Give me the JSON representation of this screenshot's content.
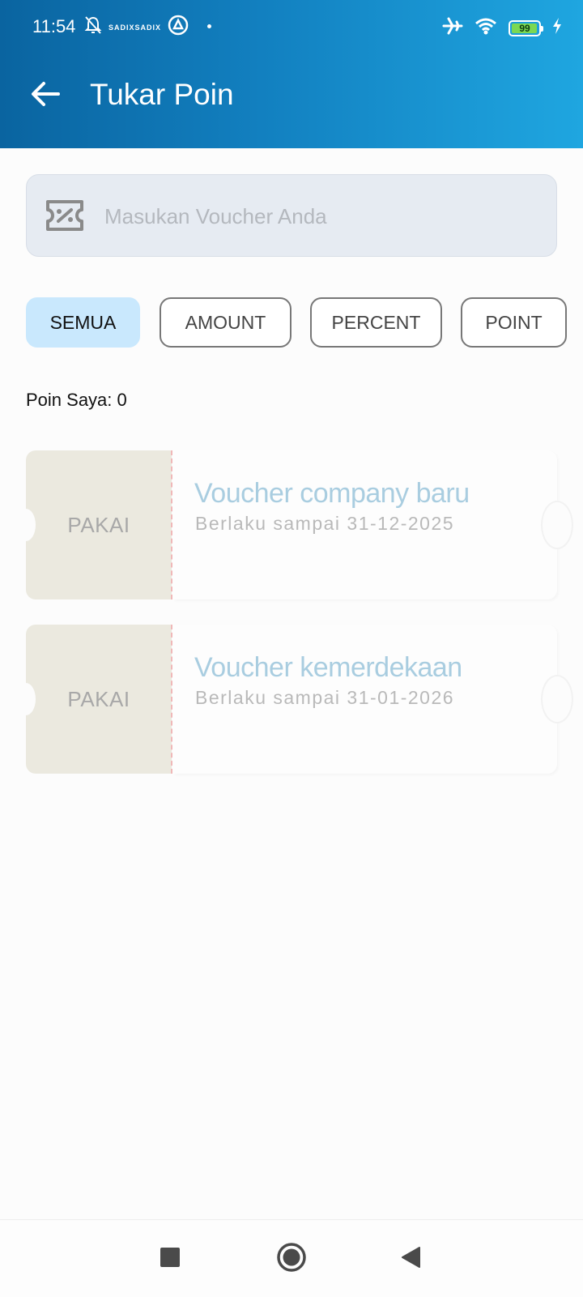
{
  "status_bar": {
    "time": "11:54",
    "carrier": "SADIXSADIX",
    "battery_level": "99",
    "icons": [
      "bell-off-icon",
      "app-circle-icon",
      "airplane-icon",
      "wifi-icon",
      "battery-icon",
      "charging-icon"
    ]
  },
  "header": {
    "title": "Tukar Poin",
    "back_icon": "arrow-left-icon",
    "gradient": [
      "#0a64a0",
      "#1fa6e0"
    ]
  },
  "search": {
    "placeholder": "Masukan Voucher Anda",
    "value": "",
    "icon": "voucher-icon"
  },
  "filters": {
    "active": "SEMUA",
    "items": [
      {
        "label": "SEMUA"
      },
      {
        "label": "AMOUNT"
      },
      {
        "label": "PERCENT"
      },
      {
        "label": "POINT"
      }
    ]
  },
  "points": {
    "label": "Poin Saya: 0"
  },
  "vouchers": [
    {
      "action": "PAKAI",
      "title": "Voucher company baru",
      "expiry": "Berlaku sampai 31-12-2025"
    },
    {
      "action": "PAKAI",
      "title": "Voucher kemerdekaan",
      "expiry": "Berlaku sampai 31-01-2026"
    }
  ],
  "nav_bar": {
    "icons": [
      "recents-square-icon",
      "home-circle-icon",
      "back-triangle-icon"
    ]
  },
  "colors": {
    "accent": "#1280c0",
    "chip_active": "#c9e8fd",
    "voucher_title": "#a9cde0",
    "stub_bg": "#ebe9df"
  }
}
